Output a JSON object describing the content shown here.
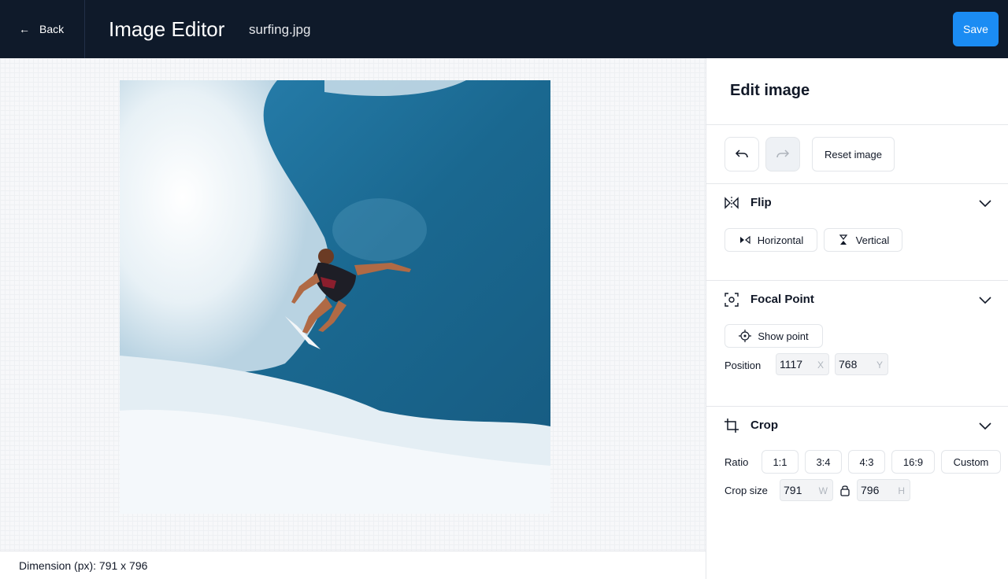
{
  "header": {
    "back_label": "Back",
    "app_title": "Image Editor",
    "file_name": "surfing.jpg",
    "save_label": "Save"
  },
  "status": {
    "dimension_text": "Dimension (px): 791 x 796"
  },
  "panel": {
    "title": "Edit image",
    "history": {
      "undo_icon": "undo-icon",
      "redo_icon": "redo-icon",
      "reset_label": "Reset image"
    },
    "flip": {
      "title": "Flip",
      "horizontal_label": "Horizontal",
      "vertical_label": "Vertical"
    },
    "focal_point": {
      "title": "Focal Point",
      "show_point_label": "Show point",
      "position_label": "Position",
      "x_value": "1117",
      "x_unit": "X",
      "y_value": "768",
      "y_unit": "Y"
    },
    "crop": {
      "title": "Crop",
      "ratio_label": "Ratio",
      "ratios": [
        "1:1",
        "3:4",
        "4:3",
        "16:9",
        "Custom"
      ],
      "size_label": "Crop size",
      "width_value": "791",
      "width_unit": "W",
      "height_value": "796",
      "height_unit": "H"
    }
  },
  "colors": {
    "header_bg": "#0f1a2a",
    "accent": "#1b8cf3",
    "ocean": "#1f6a93"
  }
}
